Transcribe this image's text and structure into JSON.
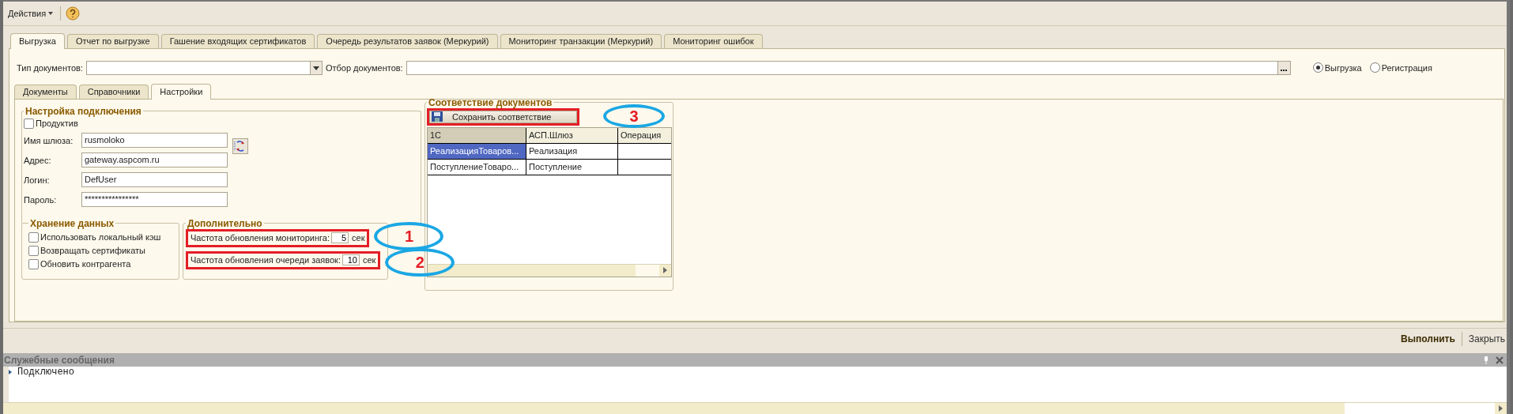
{
  "toolbar": {
    "menu": "Действия"
  },
  "tabs": [
    {
      "label": "Выгрузка",
      "selected": true
    },
    {
      "label": "Отчет по выгрузке",
      "selected": false
    },
    {
      "label": "Гашение входящих сертификатов",
      "selected": false
    },
    {
      "label": "Очередь результатов заявок (Меркурий)",
      "selected": false
    },
    {
      "label": "Мониторинг транзакции (Меркурий)",
      "selected": false
    },
    {
      "label": "Мониторинг ошибок",
      "selected": false
    }
  ],
  "filters": {
    "doc_type_label": "Тип документов:",
    "doc_filter_label": "Отбор документов:",
    "modes": [
      {
        "label": "Выгрузка",
        "selected": true
      },
      {
        "label": "Регистрация",
        "selected": false
      }
    ]
  },
  "inner_tabs": [
    {
      "label": "Документы",
      "selected": false
    },
    {
      "label": "Справочники",
      "selected": false
    },
    {
      "label": "Настройки",
      "selected": true
    }
  ],
  "connection": {
    "title": "Настройка подключения",
    "productive": {
      "label": "Продуктив",
      "checked": false
    },
    "fields": [
      {
        "label": "Имя шлюза:",
        "value": "rusmoloko"
      },
      {
        "label": "Адрес:",
        "value": "gateway.aspcom.ru"
      },
      {
        "label": "Логин:",
        "value": "DefUser"
      },
      {
        "label": "Пароль:",
        "value": "****************"
      }
    ]
  },
  "storage": {
    "title": "Хранение данных",
    "options": [
      {
        "label": "Использовать локальный кэш",
        "checked": false
      },
      {
        "label": "Возвращать сертификаты",
        "checked": false
      },
      {
        "label": "Обновить контрагента",
        "checked": false
      }
    ]
  },
  "extra": {
    "title": "Дополнительно",
    "rows": [
      {
        "label": "Частота обновления мониторинга:",
        "value": "5",
        "unit": "сек",
        "callout": "1"
      },
      {
        "label": "Частота обновления очереди заявок:",
        "value": "10",
        "unit": "сек",
        "callout": "2"
      }
    ]
  },
  "mapping": {
    "title": "Соответствие документов",
    "save_button": {
      "label": "Сохранить соответствие",
      "callout": "3"
    },
    "columns": [
      "1С",
      "АСП.Шлюз",
      "Операция"
    ],
    "rows": [
      {
        "cells": [
          "РеализацияТоваров...",
          "Реализация",
          ""
        ],
        "selected": true
      },
      {
        "cells": [
          "ПоступлениеТоваро...",
          "Поступление",
          ""
        ],
        "selected": false
      }
    ]
  },
  "commands": {
    "run": "Выполнить",
    "close": "Закрыть"
  },
  "messages": {
    "title": "Служебные сообщения",
    "lines": [
      "Подключено"
    ]
  }
}
